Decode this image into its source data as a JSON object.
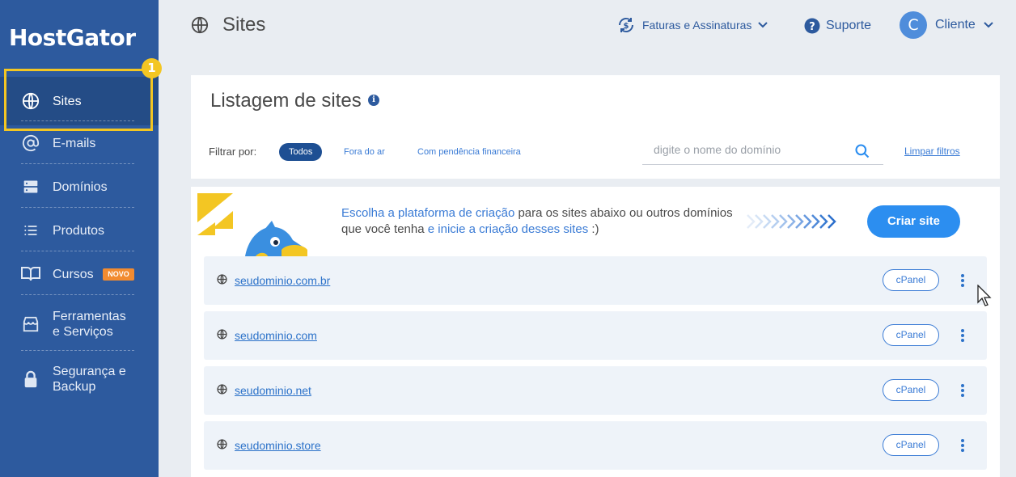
{
  "brand": {
    "logo": "HostGator",
    "accent": "#2d5a9e",
    "highlight": "#f3c623"
  },
  "step_badge": "1",
  "sidebar": {
    "items": [
      {
        "label": "Sites",
        "icon": "globe-icon",
        "active": true
      },
      {
        "label": "E-mails",
        "icon": "at-sign-icon"
      },
      {
        "label": "Domínios",
        "icon": "server-icon"
      },
      {
        "label": "Produtos",
        "icon": "list-icon"
      },
      {
        "label": "Cursos",
        "icon": "book-icon",
        "badge": "NOVO"
      },
      {
        "label_line1": "Ferramentas",
        "label_line2": "e Serviços",
        "icon": "store-icon"
      },
      {
        "label_line1": "Segurança e",
        "label_line2": "Backup",
        "icon": "lock-icon"
      }
    ]
  },
  "header": {
    "title": "Sites",
    "billing": "Faturas e Assinaturas",
    "support": "Suporte",
    "avatar_initial": "C",
    "user": "Cliente"
  },
  "listing": {
    "title": "Listagem de sites",
    "info": "i",
    "filter_label": "Filtrar por:",
    "filters": [
      "Todos",
      "Fora do ar",
      "Com pendência financeira"
    ],
    "search_placeholder": "digite o nome do domínio",
    "clear_filters": "Limpar filtros"
  },
  "promo": {
    "hl1": "Escolha a plataforma de criação",
    "text1": " para os sites abaixo ou outros domínios que você tenha ",
    "hl2": "e inicie a criação desses sites",
    "text2": " :)",
    "cta": "Criar site"
  },
  "sites": [
    {
      "domain": "seudominio.com.br",
      "action": "cPanel"
    },
    {
      "domain": "seudominio.com",
      "action": "cPanel"
    },
    {
      "domain": "seudominio.net",
      "action": "cPanel"
    },
    {
      "domain": "seudominio.store",
      "action": "cPanel"
    }
  ]
}
